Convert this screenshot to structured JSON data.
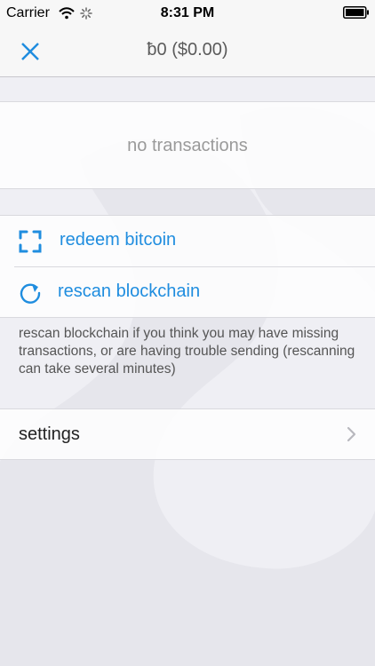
{
  "status_bar": {
    "carrier": "Carrier",
    "time": "8:31 PM"
  },
  "nav": {
    "balance": "ƀ0 ($0.00)"
  },
  "transactions": {
    "empty_text": "no transactions"
  },
  "actions": [
    {
      "label": "redeem bitcoin",
      "icon": "scan-frame-icon"
    },
    {
      "label": "rescan blockchain",
      "icon": "refresh-icon"
    }
  ],
  "rescan_hint": "rescan blockchain if you think you may have missing transactions, or are having trouble sending (rescanning can take several minutes)",
  "settings": {
    "label": "settings"
  },
  "colors": {
    "accent": "#1f8ddf",
    "background": "#efeff4"
  }
}
